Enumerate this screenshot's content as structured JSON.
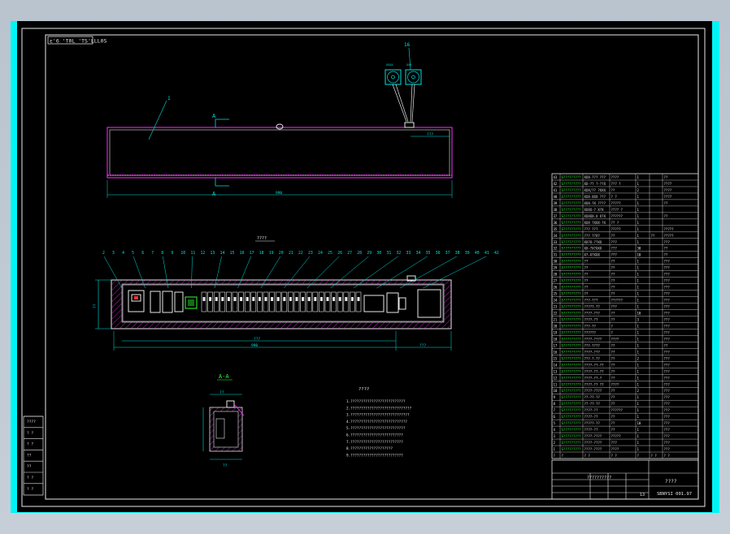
{
  "drawing": {
    "corner_code": "ɛ'6 'T0L 'TS'LLL0S",
    "title_block": {
      "top_label": "??????????",
      "name_text": "????",
      "drawing_no": "SBNYSI 001.97",
      "scale_value": "13"
    },
    "front_view": {
      "balloon_label": "1",
      "section_letter_top": "A",
      "section_letter_bottom": "A",
      "width_dim": "990",
      "fan_labels": [
        "XXXX",
        "XXX"
      ],
      "fan_balloon": "16"
    },
    "plan_view": {
      "title": "????",
      "balloons": [
        "2",
        "3",
        "4",
        "5",
        "6",
        "7",
        "8",
        "9",
        "10",
        "11",
        "12",
        "13",
        "14",
        "15",
        "16",
        "17",
        "18",
        "19",
        "20",
        "21",
        "22",
        "23",
        "24",
        "25",
        "26",
        "27",
        "28",
        "29",
        "30",
        "31",
        "32",
        "33",
        "34",
        "35",
        "36",
        "37",
        "38",
        "39",
        "40",
        "41",
        "42"
      ],
      "dim_top": "???",
      "dim_main": "990",
      "dim_right": "???",
      "dim_left": "??"
    },
    "section_view": {
      "title": "A-A",
      "dim_top": "??",
      "dim_bottom": "??"
    },
    "notes": {
      "title": "????",
      "lines": [
        "1.??????????????????????????",
        "2.?????????????????????????????",
        "3.????????????????????????????",
        "4.???????????????????????????",
        "5.??????????????????????????",
        "6.?????????????????????????",
        "7.?????????????????????????",
        "8.????????????????????",
        "9.?????????????????????????"
      ]
    },
    "left_stamp_labels": [
      "????",
      "? ?",
      "? ?",
      "??",
      "??",
      "? ?",
      "? ?"
    ],
    "bom": {
      "rows": [
        [
          "43",
          "S?????????",
          "XXX-??? ???",
          "????",
          "1",
          "",
          "??"
        ],
        [
          "42",
          "S?????????",
          "XX-?? ?-??X",
          "??? ?",
          "1",
          "",
          "????"
        ],
        [
          "41",
          "S?????????",
          "XXX/?? ?XXX",
          "??",
          "2",
          "",
          "????"
        ],
        [
          "40",
          "S?????????",
          "XXX-XXX ???",
          "? ?",
          "1",
          "",
          "????"
        ],
        [
          "39",
          "S?????????",
          "XXX-?X ????",
          "?????",
          "1",
          "",
          "??"
        ],
        [
          "38",
          "S?????????",
          "XXXX-? X?X",
          "???? ?",
          "1",
          "",
          ""
        ],
        [
          "37",
          "S?????????",
          "XXXXX-X X?X",
          "??????",
          "1",
          "",
          "??"
        ],
        [
          "36",
          "S?????????",
          "XXX ?XXX-?X",
          "?? ?",
          "1",
          "",
          ""
        ],
        [
          "35",
          "S?????????",
          "??? ???",
          "?????",
          "1",
          "",
          "?????"
        ],
        [
          "34",
          "S?????????",
          "??? ??X?",
          "??",
          "1",
          "??",
          "?????"
        ],
        [
          "33",
          "S?????????",
          "XX?X-??XX",
          "???",
          "1",
          "",
          "???"
        ],
        [
          "32",
          "S?????????",
          "XX-?X?XXX",
          "???",
          "30",
          "",
          "??"
        ],
        [
          "31",
          "S?????????",
          "X?-X?XXX",
          "???",
          "10",
          "",
          "??"
        ],
        [
          "30",
          "S?????????",
          "??",
          "??",
          "1",
          "",
          "???"
        ],
        [
          "29",
          "S?????????",
          "??",
          "??",
          "1",
          "",
          "???"
        ],
        [
          "28",
          "S?????????",
          "??",
          "??",
          "1",
          "",
          "???"
        ],
        [
          "27",
          "S?????????",
          "??",
          "??",
          "1",
          "",
          "???"
        ],
        [
          "26",
          "S?????????",
          "??",
          "??",
          "1",
          "",
          "???"
        ],
        [
          "25",
          "S?????????",
          "??",
          "??",
          "1",
          "",
          "???"
        ],
        [
          "24",
          "S?????????",
          "???-???",
          "??????",
          "1",
          "",
          "???"
        ],
        [
          "23",
          "S?????????",
          "?????-??",
          "???",
          "1",
          "",
          "???"
        ],
        [
          "22",
          "S?????????",
          "????-???",
          "??",
          "10",
          "",
          "???"
        ],
        [
          "21",
          "S?????????",
          "????-??",
          "??",
          "3",
          "",
          "???"
        ],
        [
          "20",
          "S?????????",
          "???-??",
          "?",
          "1",
          "",
          "???"
        ],
        [
          "19",
          "S?????????",
          "??????",
          "?",
          "1",
          "",
          "???"
        ],
        [
          "18",
          "S?????????",
          "????-????",
          "????",
          "1",
          "",
          "???"
        ],
        [
          "17",
          "S?????????",
          "???-????",
          "??",
          "1",
          "",
          "??"
        ],
        [
          "16",
          "S?????????",
          "????-???",
          "??",
          "1",
          "",
          "???"
        ],
        [
          "15",
          "S?????????",
          "???-?-??",
          "??",
          "2",
          "",
          "???"
        ],
        [
          "14",
          "S?????????",
          "????-??-??",
          "??",
          "1",
          "",
          "???"
        ],
        [
          "13",
          "S?????????",
          "????-??-??",
          "??",
          "1",
          "",
          "???"
        ],
        [
          "12",
          "S?????????",
          "????-??-?",
          "??",
          "1",
          "",
          "???"
        ],
        [
          "11",
          "S?????????",
          "????-?? ??",
          "????",
          "1",
          "",
          "???"
        ],
        [
          "10",
          "S?????????",
          "????-????",
          "??",
          "2",
          "",
          "???"
        ],
        [
          "9",
          "S?????????",
          "??-??-??",
          "??",
          "1",
          "",
          "???"
        ],
        [
          "8",
          "S?????????",
          "??-??-??",
          "??",
          "1",
          "",
          "???"
        ],
        [
          "7",
          "S?????????",
          "????-??",
          "??????",
          "1",
          "",
          "???"
        ],
        [
          "6",
          "S?????????",
          "????-??",
          "??",
          "1",
          "",
          "???"
        ],
        [
          "5",
          "S?????????",
          "?????-??",
          "??",
          "10",
          "",
          "???"
        ],
        [
          "4",
          "S?????????",
          "????-??",
          "??",
          "1",
          "",
          "???"
        ],
        [
          "3",
          "S?????????",
          "????-????",
          "?????",
          "1",
          "",
          "???"
        ],
        [
          "2",
          "S?????????",
          "????-????",
          "???",
          "1",
          "",
          "???"
        ],
        [
          "1",
          "S?????????",
          "????-????",
          "????",
          "1",
          "",
          "???"
        ]
      ],
      "header": [
        "?",
        "?",
        "? ?",
        "? ?",
        "?",
        "? ?",
        "? ?"
      ]
    }
  }
}
